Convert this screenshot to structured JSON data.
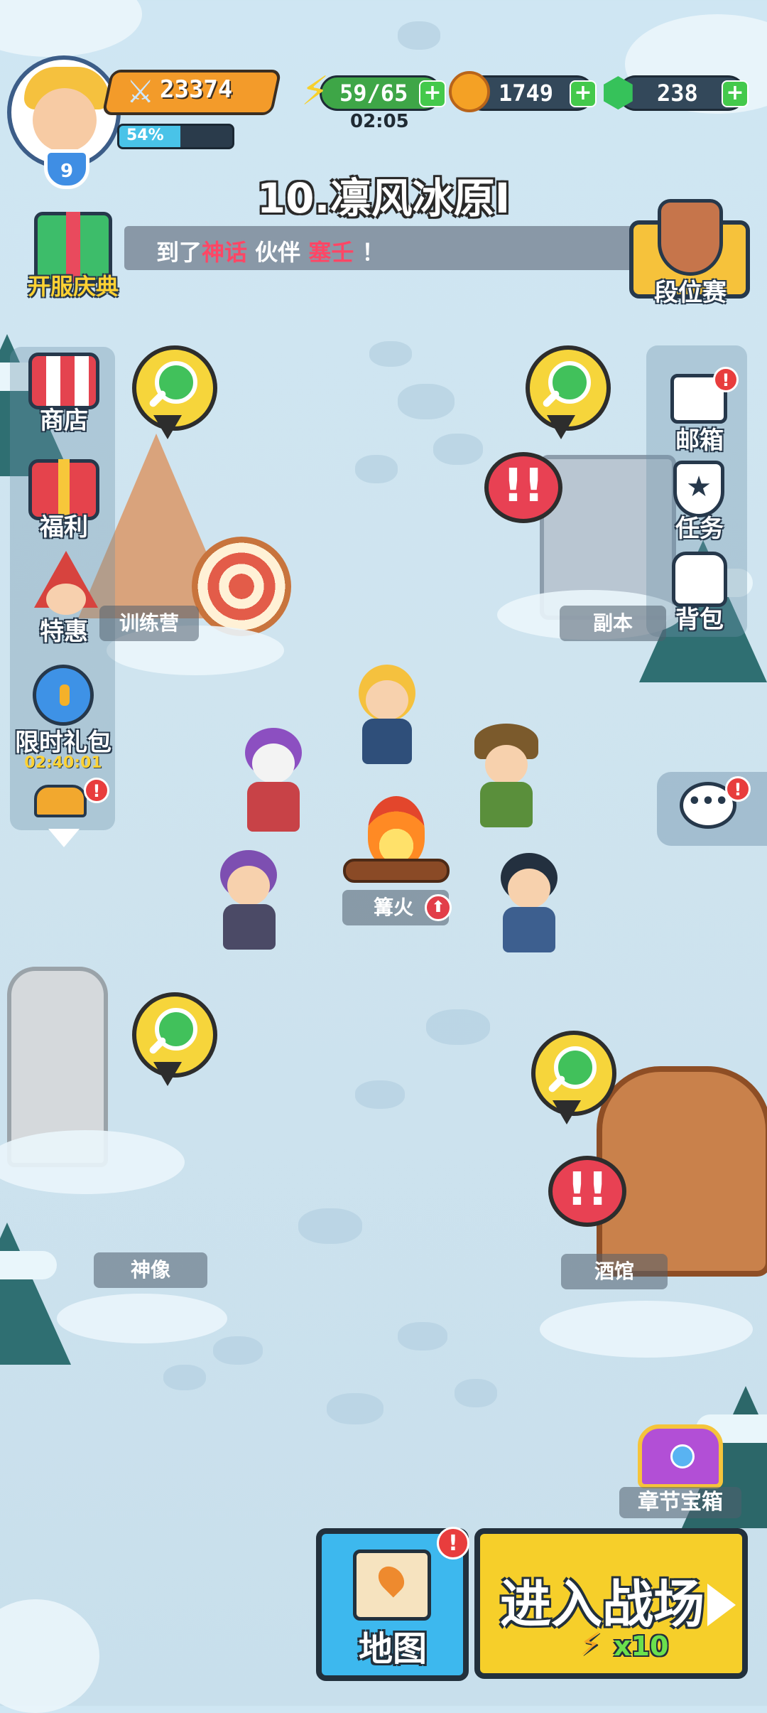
{
  "hud": {
    "level": "9",
    "power": "23374",
    "exp_percent": "54%",
    "exp_fraction": 0.54,
    "energy": "59/65",
    "energy_timer": "02:05",
    "gold": "1749",
    "gems": "238",
    "plus": "+"
  },
  "stage_title": "10.凛风冰原I",
  "ticker": {
    "prefix": "到了",
    "highlight1": "神话",
    "middle": "伙伴",
    "highlight2": "塞壬",
    "suffix": "！"
  },
  "left_menu": {
    "celebration": "开服庆典",
    "shop": "商店",
    "welfare": "福利",
    "special": "特惠",
    "limited_pack": "限时礼包",
    "limited_timer": "02:40:01",
    "badge": "!"
  },
  "right_menu": {
    "rank": "段位赛",
    "mail": "邮箱",
    "tasks": "任务",
    "bag": "背包",
    "badge": "!"
  },
  "places": {
    "training": "训练营",
    "dungeon": "副本",
    "bonfire": "篝火",
    "statue": "神像",
    "tavern": "酒馆",
    "chapter_chest": "章节宝箱"
  },
  "alerts": {
    "symbol": "!!"
  },
  "bottom": {
    "map": "地图",
    "battle": "进入战场",
    "cost": "x10",
    "badge": "!"
  },
  "icons": [
    "sword-icon",
    "lightning-icon",
    "gold-coin-icon",
    "gem-icon",
    "shop-icon",
    "gift-icon",
    "witch-icon",
    "stopwatch-icon",
    "mail-icon",
    "star-shield-icon",
    "backpack-icon",
    "chat-icon",
    "magnifier-icon",
    "map-scroll-icon",
    "play-arrow-icon",
    "treasure-chest-icon"
  ]
}
